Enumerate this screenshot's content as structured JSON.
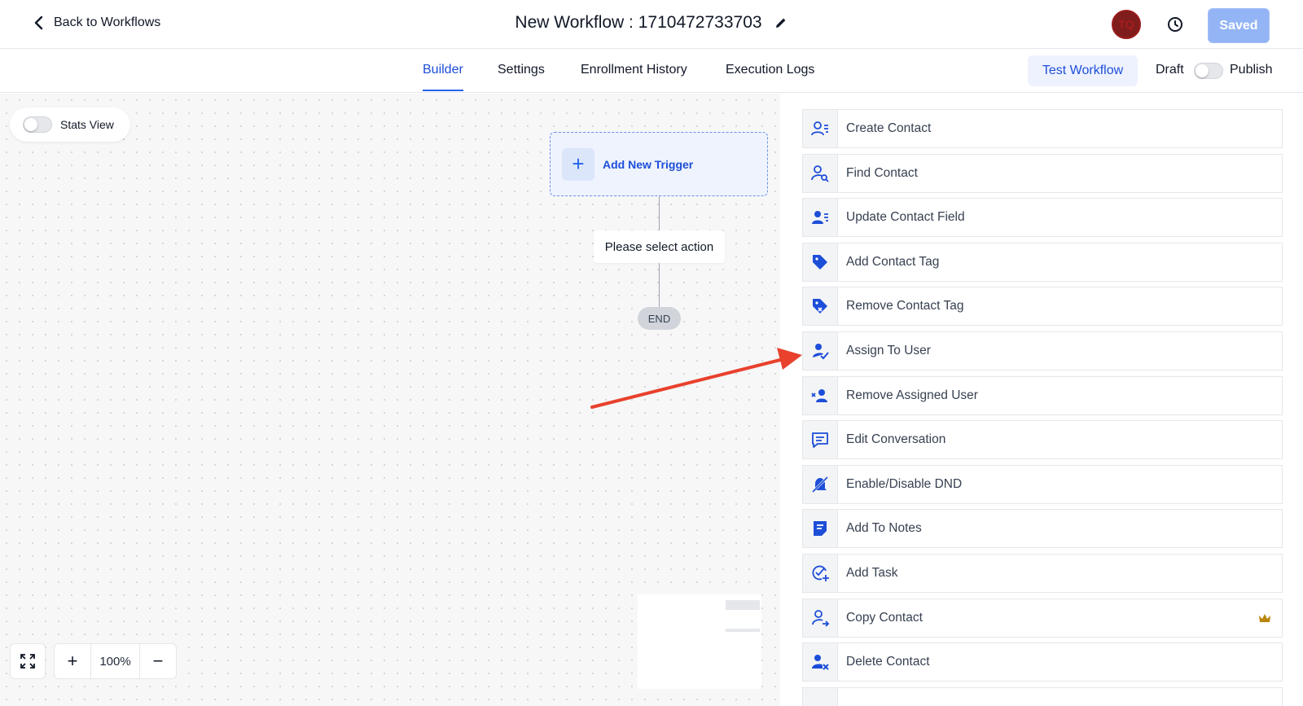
{
  "header": {
    "back_label": "Back to Workflows",
    "title": "New Workflow : 1710472733703",
    "avatar_initials": "TQ",
    "saved_label": "Saved"
  },
  "tabs": [
    {
      "label": "Builder",
      "active": true
    },
    {
      "label": "Settings",
      "active": false
    },
    {
      "label": "Enrollment History",
      "active": false
    },
    {
      "label": "Execution Logs",
      "active": false
    }
  ],
  "toolbar": {
    "test_label": "Test Workflow",
    "draft_label": "Draft",
    "publish_label": "Publish"
  },
  "canvas": {
    "stats_label": "Stats View",
    "trigger_label": "Add New Trigger",
    "select_action_label": "Please select action",
    "end_label": "END",
    "zoom": "100%"
  },
  "actions": [
    {
      "label": "Create Contact",
      "icon": "user-list-icon"
    },
    {
      "label": "Find Contact",
      "icon": "user-search-icon"
    },
    {
      "label": "Update Contact Field",
      "icon": "user-edit-icon"
    },
    {
      "label": "Add Contact Tag",
      "icon": "tag-icon"
    },
    {
      "label": "Remove Contact Tag",
      "icon": "tag-remove-icon"
    },
    {
      "label": "Assign To User",
      "icon": "user-assign-icon"
    },
    {
      "label": "Remove Assigned User",
      "icon": "user-remove-icon"
    },
    {
      "label": "Edit Conversation",
      "icon": "chat-icon"
    },
    {
      "label": "Enable/Disable DND",
      "icon": "bell-off-icon"
    },
    {
      "label": "Add To Notes",
      "icon": "note-icon"
    },
    {
      "label": "Add Task",
      "icon": "task-icon"
    },
    {
      "label": "Copy Contact",
      "icon": "user-copy-icon",
      "premium": true
    },
    {
      "label": "Delete Contact",
      "icon": "user-delete-icon"
    }
  ],
  "colors": {
    "accent": "#2563eb",
    "annotation_arrow": "#e8412c"
  }
}
